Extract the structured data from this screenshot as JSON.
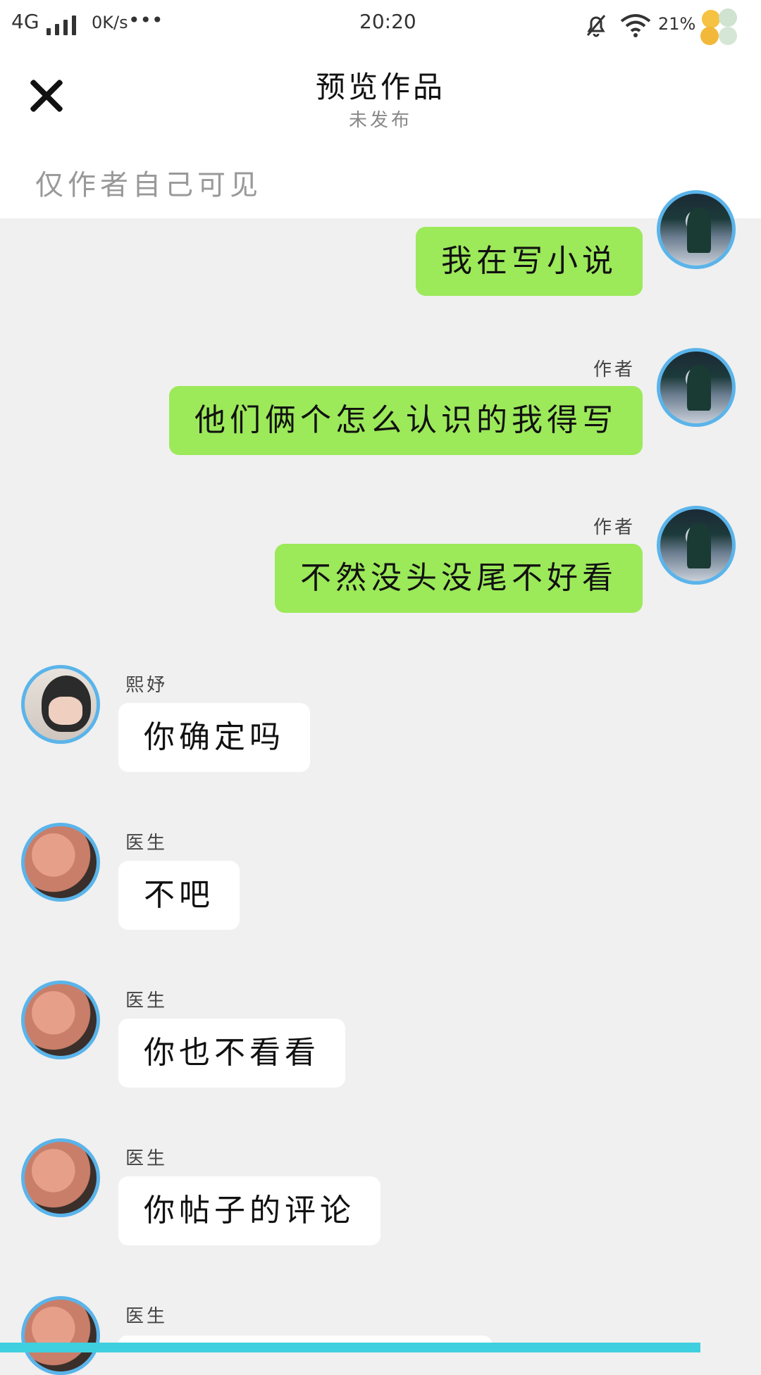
{
  "status_bar": {
    "network": "4G",
    "speed": "0K/s",
    "dots": "•••",
    "time": "20:20",
    "battery": "21%"
  },
  "header": {
    "title": "预览作品",
    "subtitle": "未发布",
    "visibility_note": "仅作者自己可见"
  },
  "messages": [
    {
      "side": "right",
      "name": "",
      "text": "我在写小说"
    },
    {
      "side": "right",
      "name": "作者",
      "text": "他们俩个怎么认识的我得写"
    },
    {
      "side": "right",
      "name": "作者",
      "text": "不然没头没尾不好看"
    },
    {
      "side": "left",
      "name": "熙妤",
      "text": "你确定吗"
    },
    {
      "side": "left",
      "name": "医生",
      "text": "不吧"
    },
    {
      "side": "left",
      "name": "医生",
      "text": "你也不看看"
    },
    {
      "side": "left",
      "name": "医生",
      "text": "你帖子的评论"
    },
    {
      "side": "left",
      "name": "医生",
      "text": ""
    }
  ],
  "colors": {
    "accent_border": "#5ab4ea",
    "green_bubble": "#9ce95a",
    "bottom_bar": "#3fd0df"
  }
}
